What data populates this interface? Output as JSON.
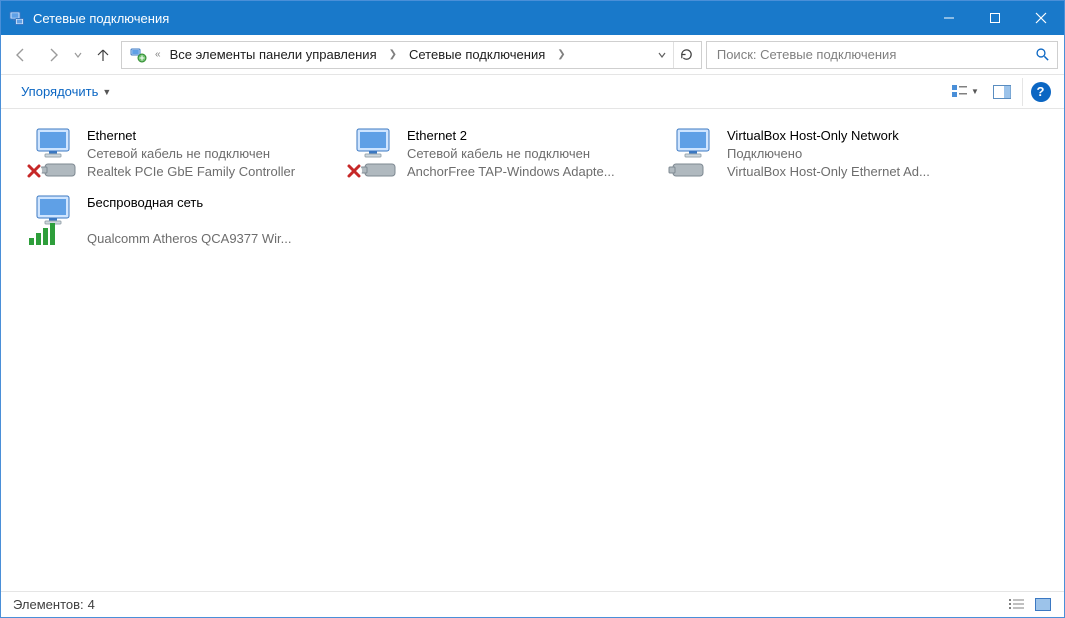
{
  "window": {
    "title": "Сетевые подключения"
  },
  "breadcrumb": {
    "seg1": "Все элементы панели управления",
    "seg2": "Сетевые подключения"
  },
  "search": {
    "placeholder": "Поиск: Сетевые подключения"
  },
  "commands": {
    "organize": "Упорядочить"
  },
  "adapters": [
    {
      "name": "Ethernet",
      "status": "Сетевой кабель не подключен",
      "device": "Realtek PCIe GbE Family Controller",
      "state": "disconnected"
    },
    {
      "name": "Ethernet 2",
      "status": "Сетевой кабель не подключен",
      "device": "AnchorFree TAP-Windows Adapte...",
      "state": "disconnected"
    },
    {
      "name": "VirtualBox Host-Only Network",
      "status": "Подключено",
      "device": "VirtualBox Host-Only Ethernet Ad...",
      "state": "connected"
    },
    {
      "name": "Беспроводная сеть",
      "status": "",
      "device": "Qualcomm Atheros QCA9377 Wir...",
      "state": "wireless"
    }
  ],
  "statusbar": {
    "label": "Элементов:",
    "count": "4"
  }
}
